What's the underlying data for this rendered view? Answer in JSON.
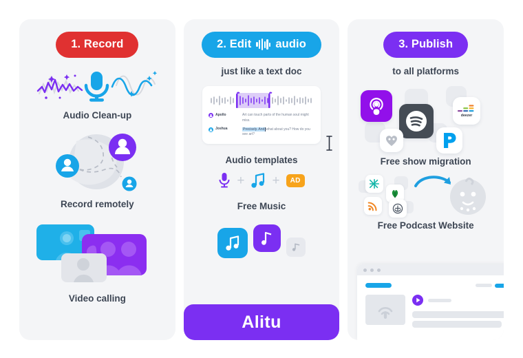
{
  "theme": {
    "page_bg": "#ffffff",
    "card_bg": "#f4f5f7",
    "red": "#e03131",
    "blue": "#18a5e8",
    "purple": "#7b2ff2",
    "orange": "#f7a31b",
    "text": "#3d4654",
    "muted": "#7b8596"
  },
  "cards": [
    {
      "badge": "1. Record",
      "badge_color": "#e03131",
      "features": [
        {
          "icon": "audio-waveform-microphone-icon",
          "caption": "Audio Clean-up"
        },
        {
          "icon": "globe-participants-icon",
          "caption": "Record remotely"
        },
        {
          "icon": "video-call-tiles-icon",
          "caption": "Video calling"
        }
      ]
    },
    {
      "badge_prefix": "2. Edit",
      "badge_suffix": "audio",
      "badge_icon": "audio-bars-icon",
      "badge_color": "#18a5e8",
      "subtitle": "just like a text doc",
      "editor": {
        "icon": "waveform-selection-icon",
        "transcript": [
          {
            "speaker": "Apollo",
            "avatar_color": "#7b2ff2",
            "text": "Art can touch parts of the human soul might miss."
          },
          {
            "speaker": "Joshua",
            "avatar_color": "#18a5e8",
            "highlight": "Precisely. And",
            "text": "what about you? How do you see art?"
          }
        ],
        "cursor_icon": "text-caret-icon"
      },
      "templates": {
        "title": "Audio templates",
        "items": [
          {
            "icon": "microphone-icon",
            "label": ""
          },
          {
            "icon": "plus-icon",
            "label": "+"
          },
          {
            "icon": "music-note-icon",
            "label": ""
          },
          {
            "icon": "plus-icon",
            "label": "+"
          },
          {
            "icon": "ad-chip-icon",
            "label": "AD"
          }
        ]
      },
      "music": {
        "title": "Free Music",
        "tiles": [
          {
            "icon": "music-note-icon",
            "color": "#18a5e8"
          },
          {
            "icon": "music-note-icon",
            "color": "#7b2ff2"
          },
          {
            "icon": "music-note-icon",
            "color": "#e7e9ee"
          }
        ]
      },
      "cta": "Alitu"
    },
    {
      "badge": "3. Publish",
      "badge_color": "#7b2ff2",
      "subtitle": "to all platforms",
      "platforms": [
        {
          "name": "apple-podcasts",
          "label": ""
        },
        {
          "name": "spotify",
          "label": ""
        },
        {
          "name": "deezer",
          "label": "deezer"
        },
        {
          "name": "iheartradio",
          "label": ""
        },
        {
          "name": "pandora",
          "label": ""
        }
      ],
      "migration_caption": "Free show migration",
      "migration_sources": [
        {
          "name": "libsyn-icon"
        },
        {
          "name": "podbean-icon"
        },
        {
          "name": "rss-feed-icon"
        },
        {
          "name": "anchor-icon"
        }
      ],
      "migration_target": "alitu-mascot-icon",
      "website_caption": "Free Podcast Website"
    }
  ]
}
